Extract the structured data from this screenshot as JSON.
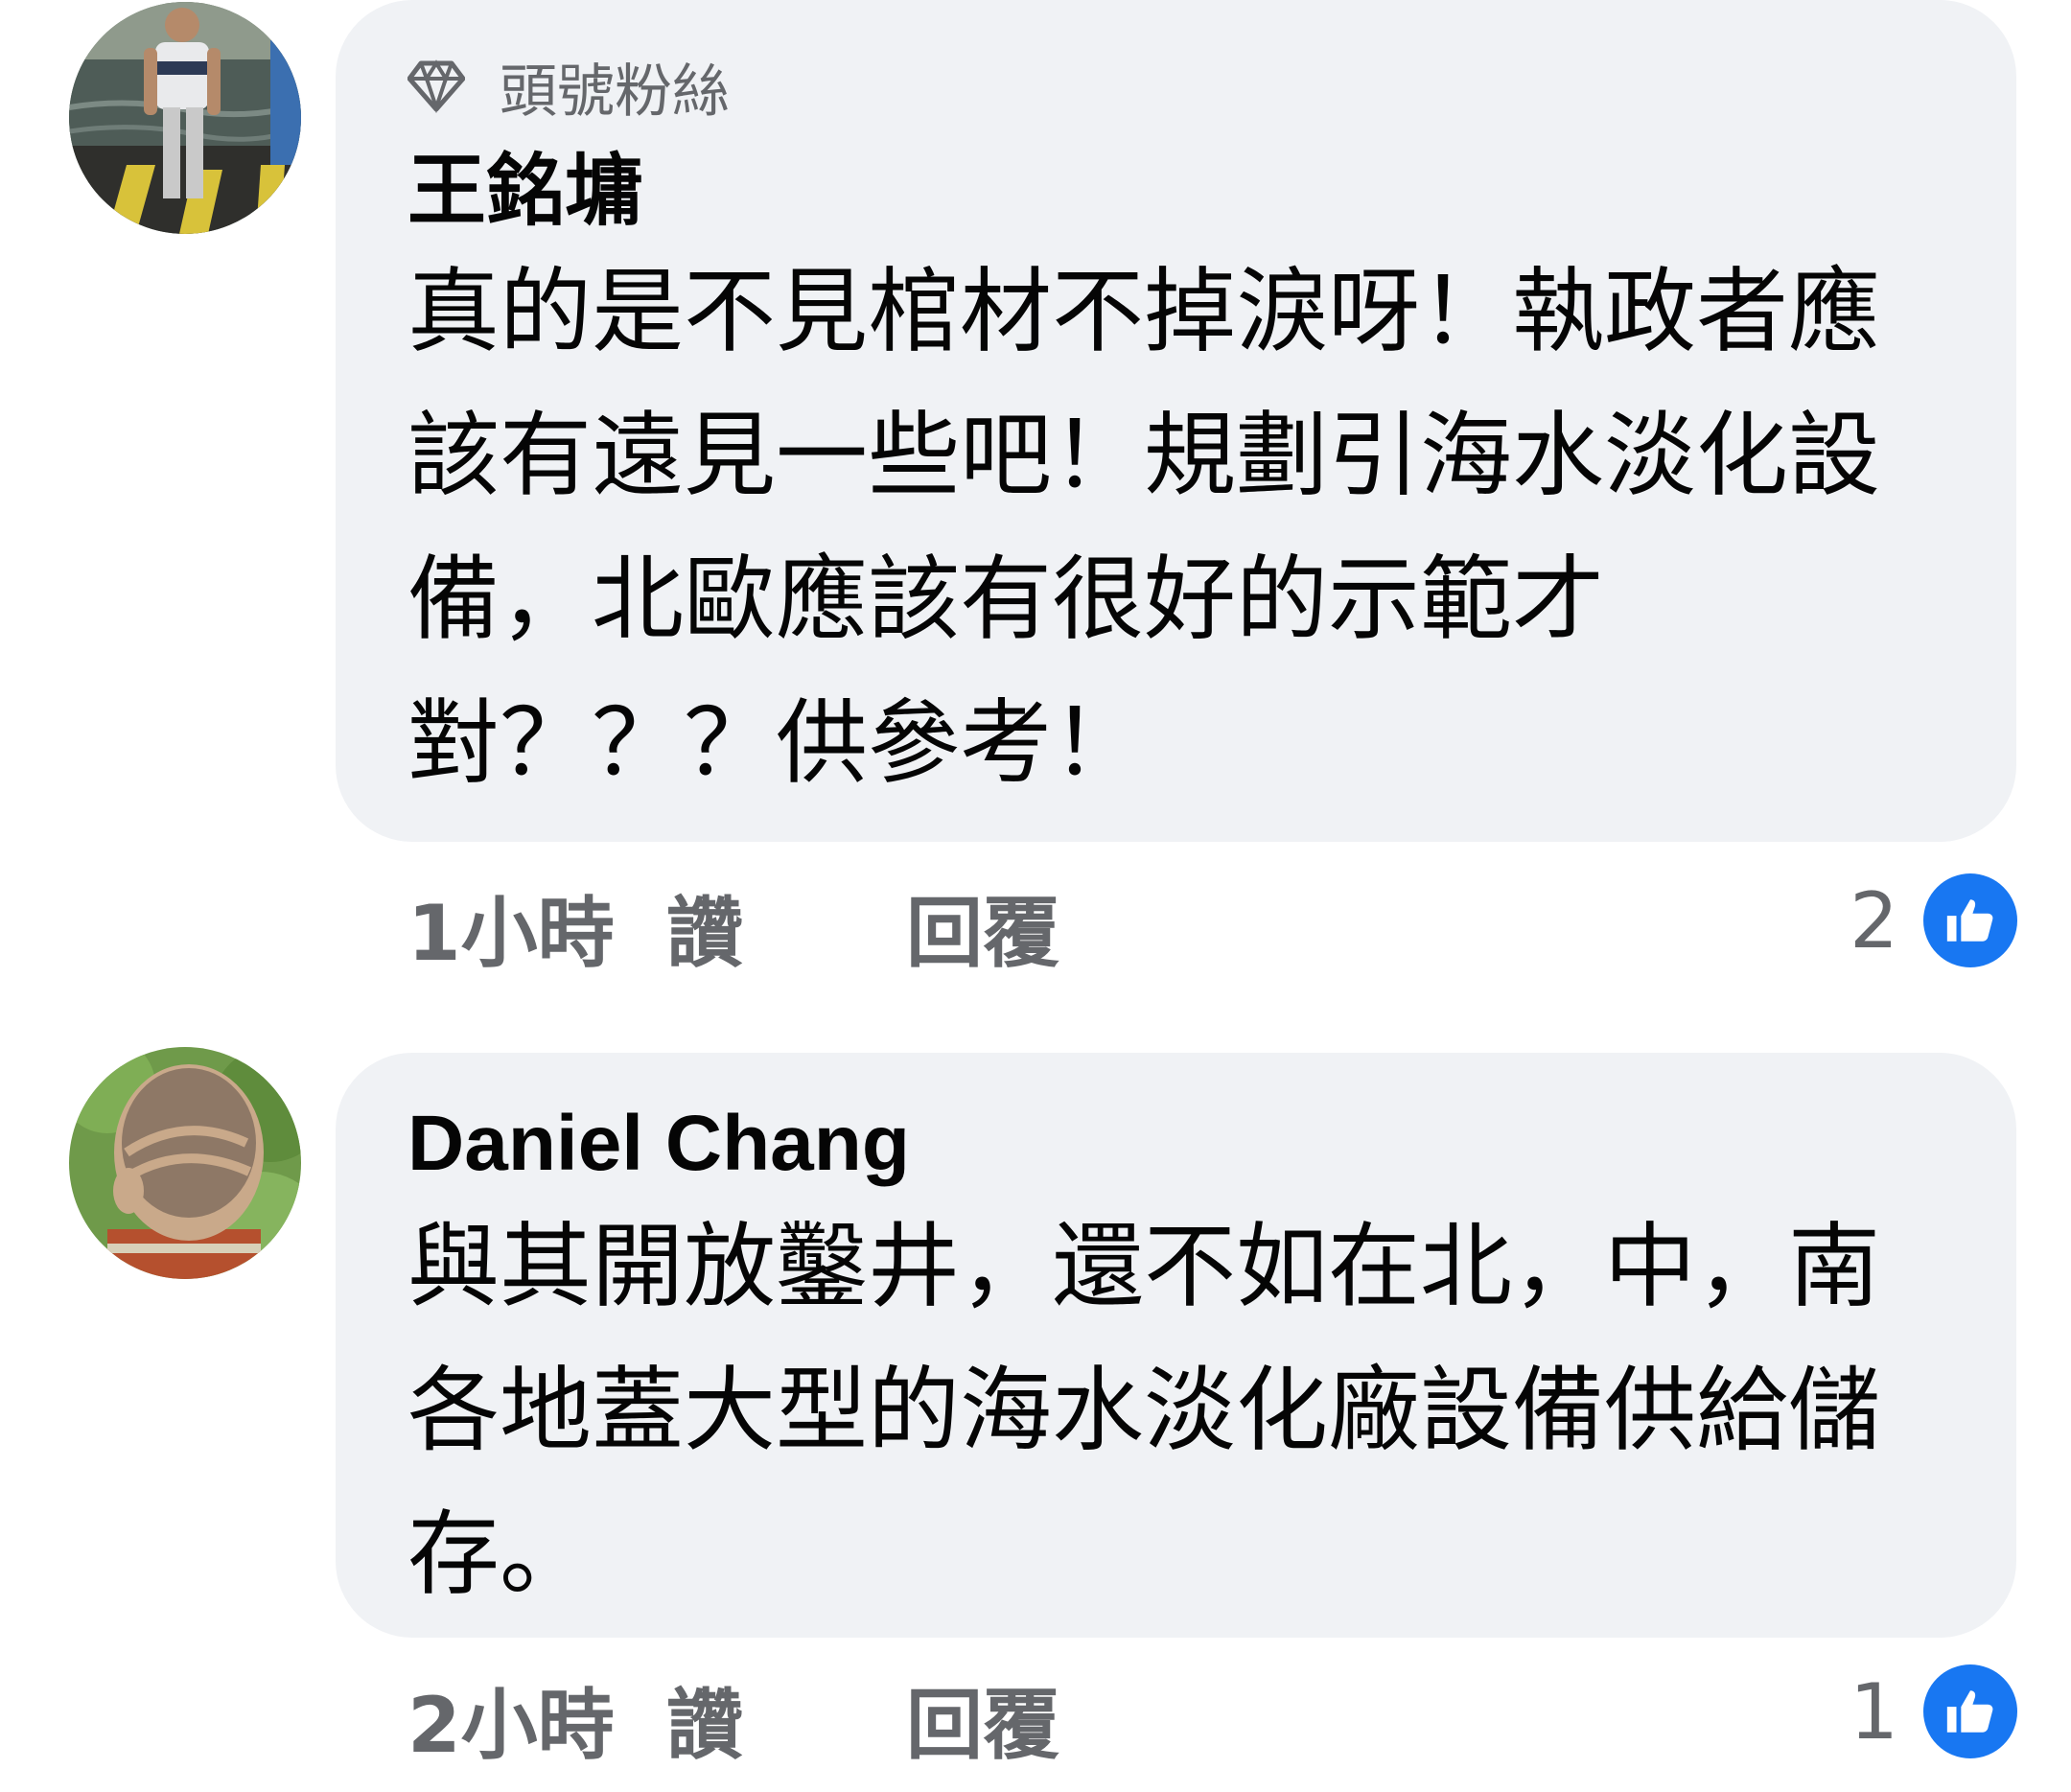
{
  "comments": [
    {
      "badge": "頭號粉絲",
      "author": "王銘墉",
      "text": "真的是不見棺材不掉淚呀！執政者應該有遠見一些吧！規劃引海水淡化設備，北歐應該有很好的示範才對？？？供參考！",
      "time": "1小時",
      "like_label": "讚",
      "reply_label": "回覆",
      "reaction_count": "2",
      "avatar_icon": "profile-photo-man-by-water",
      "reaction_icon": "thumbs-up-icon"
    },
    {
      "author": "Daniel Chang",
      "text": "與其開放鑿井，還不如在北，中，南各地蓋大型的海水淡化廠設備供給儲存。",
      "time": "2小時",
      "like_label": "讚",
      "reply_label": "回覆",
      "reaction_count": "1",
      "avatar_icon": "profile-photo-child-head",
      "reaction_icon": "thumbs-up-icon"
    }
  ],
  "colors": {
    "bubble": "#f0f2f5",
    "secondary_text": "#65676b",
    "like_blue": "#1877f2"
  }
}
